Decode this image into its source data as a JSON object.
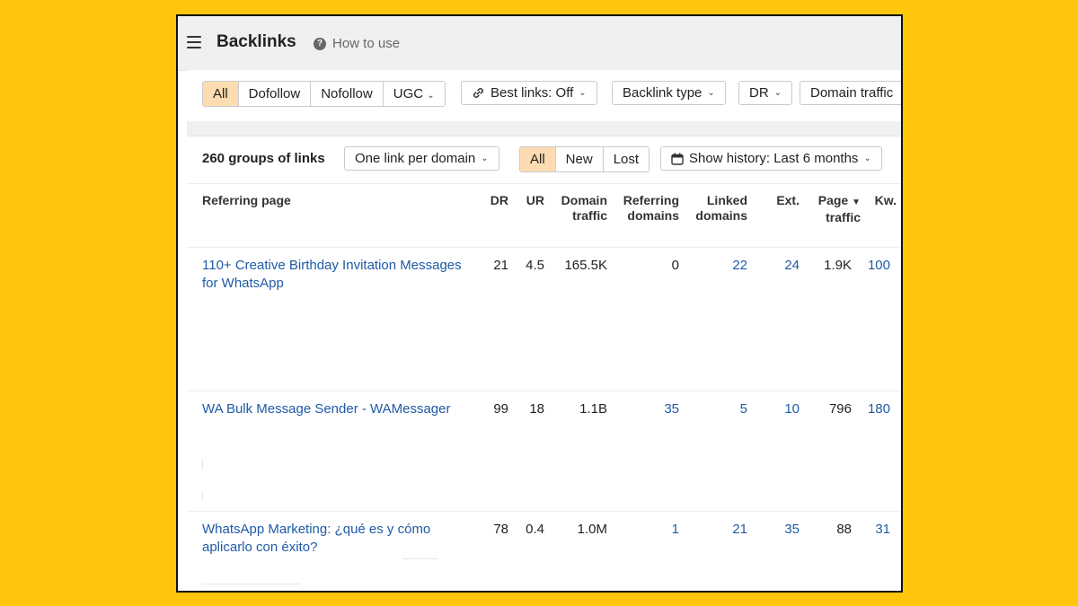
{
  "header": {
    "title": "Backlinks",
    "help_label": "How to use"
  },
  "filters": {
    "link_types": [
      "All",
      "Dofollow",
      "Nofollow",
      "UGC"
    ],
    "best_links": "Best links: Off",
    "backlink_type": "Backlink type",
    "dr": "DR",
    "domain_traffic": "Domain traffic"
  },
  "toolbar": {
    "groups_count": "260 groups of links",
    "grouping": "One link per domain",
    "status_tabs": [
      "All",
      "New",
      "Lost"
    ],
    "history": "Show history: Last 6 months"
  },
  "table": {
    "headers": {
      "referring_page": "Referring page",
      "dr": "DR",
      "ur": "UR",
      "domain_traffic_1": "Domain",
      "domain_traffic_2": "traffic",
      "referring_domains_1": "Referring",
      "referring_domains_2": "domains",
      "linked_domains_1": "Linked",
      "linked_domains_2": "domains",
      "ext": "Ext.",
      "page_traffic_1": "Page",
      "page_traffic_2": "traffic",
      "kw": "Kw."
    },
    "rows": [
      {
        "title": "110+ Creative Birthday Invitation Messages for WhatsApp",
        "dr": "21",
        "ur": "4.5",
        "domain_traffic": "165.5K",
        "referring_domains": "0",
        "linked_domains": "22",
        "ext": "24",
        "page_traffic": "1.9K",
        "kw": "100"
      },
      {
        "title": "WA Bulk Message Sender - WAMessager",
        "dr": "99",
        "ur": "18",
        "domain_traffic": "1.1B",
        "referring_domains": "35",
        "linked_domains": "5",
        "ext": "10",
        "page_traffic": "796",
        "kw": "180"
      },
      {
        "title": "WhatsApp Marketing: ¿qué es y cómo aplicarlo con éxito?",
        "dr": "78",
        "ur": "0.4",
        "domain_traffic": "1.0M",
        "referring_domains": "1",
        "linked_domains": "21",
        "ext": "35",
        "page_traffic": "88",
        "kw": "31"
      }
    ]
  },
  "colors": {
    "background": "#ffc60b",
    "active_chip": "#fcdcb0",
    "link": "#1f5aa6"
  },
  "icons": [
    "menu-icon",
    "help-icon",
    "link-icon",
    "calendar-icon",
    "chevron-down-icon",
    "sort-desc-icon"
  ]
}
